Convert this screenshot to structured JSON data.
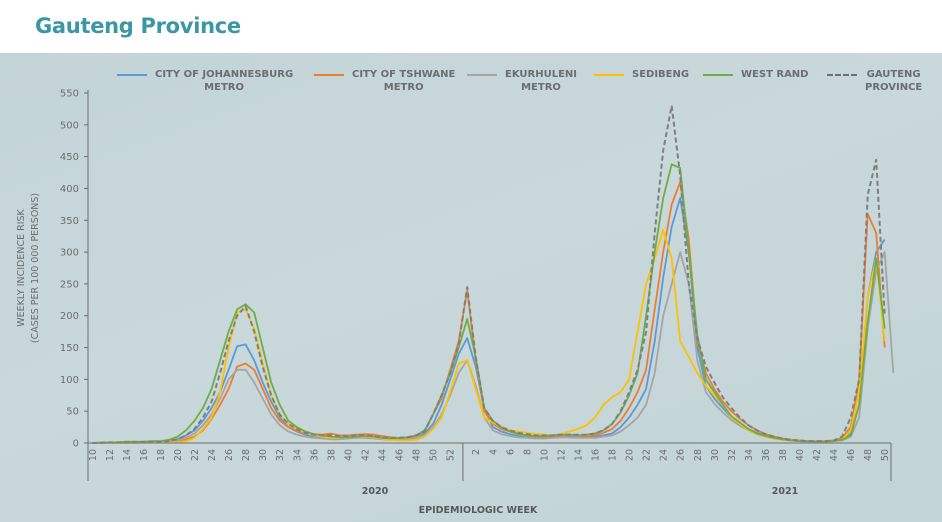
{
  "header": {
    "title": "Gauteng Province"
  },
  "chart_data": {
    "type": "line",
    "title": "Gauteng Province",
    "xlabel": "EPIDEMIOLOGIC WEEK",
    "ylabel_line1": "WEEKLY INCIDENCE RISK",
    "ylabel_line2": "(CASES PER 100 000 PERSONS)",
    "ylim": [
      0,
      550
    ],
    "yticks": [
      0,
      50,
      100,
      150,
      200,
      250,
      300,
      350,
      400,
      450,
      500,
      550
    ],
    "grid": false,
    "legend_position": "top",
    "year_groups": [
      {
        "label": "2020",
        "weeks": [
          10,
          11,
          12,
          13,
          14,
          15,
          16,
          17,
          18,
          19,
          20,
          21,
          22,
          23,
          24,
          25,
          26,
          27,
          28,
          29,
          30,
          31,
          32,
          33,
          34,
          35,
          36,
          37,
          38,
          39,
          40,
          41,
          42,
          43,
          44,
          45,
          46,
          47,
          48,
          49,
          50,
          51,
          52,
          53
        ]
      },
      {
        "label": "2021",
        "weeks": [
          1,
          2,
          3,
          4,
          5,
          6,
          7,
          8,
          9,
          10,
          11,
          12,
          13,
          14,
          15,
          16,
          17,
          18,
          19,
          20,
          21,
          22,
          23,
          24,
          25,
          26,
          27,
          28,
          29,
          30,
          31,
          32,
          33,
          34,
          35,
          36,
          37,
          38,
          39,
          40,
          41,
          42,
          43,
          44,
          45,
          46,
          47,
          48,
          49,
          50
        ]
      }
    ],
    "xtick_labels_2020": [
      "10",
      "12",
      "14",
      "16",
      "18",
      "20",
      "22",
      "24",
      "26",
      "28",
      "30",
      "32",
      "34",
      "36",
      "38",
      "40",
      "42",
      "44",
      "46",
      "48",
      "50",
      "52"
    ],
    "xtick_labels_2021": [
      "2",
      "4",
      "6",
      "8",
      "10",
      "12",
      "14",
      "16",
      "18",
      "20",
      "22",
      "24",
      "26",
      "28",
      "30",
      "32",
      "34",
      "36",
      "38",
      "40",
      "42",
      "44",
      "46",
      "48",
      "50"
    ],
    "series": [
      {
        "name": "CITY OF JOHANNESBURG METRO",
        "legend_line1": "CITY OF JOHANNESBURG",
        "legend_line2": "METRO",
        "color": "#5b9bd5",
        "dashed": false,
        "values": [
          0,
          0,
          1,
          1,
          1,
          1,
          1,
          2,
          2,
          3,
          6,
          12,
          20,
          35,
          55,
          80,
          115,
          152,
          155,
          130,
          95,
          65,
          40,
          25,
          18,
          13,
          10,
          9,
          8,
          8,
          9,
          10,
          10,
          9,
          8,
          7,
          7,
          8,
          10,
          15,
          30,
          60,
          100,
          140,
          165,
          120,
          55,
          25,
          18,
          14,
          11,
          9,
          8,
          8,
          9,
          10,
          10,
          9,
          9,
          10,
          12,
          15,
          25,
          40,
          60,
          85,
          160,
          260,
          340,
          385,
          300,
          150,
          90,
          70,
          55,
          40,
          30,
          22,
          16,
          12,
          8,
          6,
          4,
          3,
          2,
          2,
          2,
          3,
          5,
          15,
          60,
          230,
          300,
          320
        ]
      },
      {
        "name": "CITY OF TSHWANE METRO",
        "legend_line1": "CITY OF TSHWANE",
        "legend_line2": "METRO",
        "color": "#ed7d31",
        "dashed": false,
        "values": [
          0,
          0,
          1,
          1,
          1,
          1,
          1,
          1,
          2,
          2,
          3,
          5,
          10,
          20,
          38,
          60,
          85,
          120,
          125,
          115,
          85,
          55,
          35,
          25,
          20,
          15,
          14,
          13,
          15,
          12,
          12,
          13,
          14,
          13,
          11,
          9,
          8,
          9,
          11,
          18,
          45,
          70,
          115,
          160,
          240,
          130,
          50,
          30,
          22,
          18,
          15,
          12,
          10,
          10,
          10,
          10,
          9,
          9,
          10,
          12,
          16,
          22,
          35,
          55,
          80,
          115,
          210,
          300,
          375,
          410,
          320,
          160,
          110,
          85,
          65,
          50,
          38,
          28,
          20,
          14,
          10,
          7,
          5,
          4,
          3,
          3,
          3,
          4,
          8,
          25,
          100,
          360,
          330,
          150
        ]
      },
      {
        "name": "EKURHULENI METRO",
        "legend_line1": "EKURHULENI",
        "legend_line2": "METRO",
        "color": "#a5a5a5",
        "dashed": false,
        "values": [
          0,
          0,
          1,
          1,
          1,
          1,
          1,
          1,
          1,
          2,
          4,
          8,
          15,
          28,
          45,
          70,
          100,
          115,
          115,
          95,
          70,
          45,
          28,
          18,
          13,
          10,
          8,
          7,
          6,
          6,
          7,
          8,
          8,
          7,
          6,
          5,
          5,
          6,
          8,
          12,
          25,
          45,
          75,
          110,
          130,
          90,
          40,
          20,
          14,
          11,
          9,
          8,
          7,
          7,
          8,
          9,
          9,
          8,
          8,
          8,
          10,
          12,
          18,
          28,
          40,
          60,
          110,
          200,
          250,
          300,
          250,
          130,
          80,
          62,
          48,
          36,
          27,
          20,
          14,
          10,
          7,
          5,
          4,
          3,
          2,
          2,
          2,
          3,
          4,
          10,
          40,
          180,
          270,
          300,
          110
        ]
      },
      {
        "name": "SEDIBENG",
        "legend_line1": "SEDIBENG",
        "legend_line2": "",
        "color": "#ffc000",
        "dashed": false,
        "values": [
          0,
          0,
          0,
          0,
          0,
          0,
          1,
          1,
          1,
          1,
          1,
          3,
          8,
          22,
          40,
          80,
          150,
          205,
          210,
          180,
          125,
          75,
          45,
          30,
          22,
          16,
          12,
          10,
          8,
          8,
          9,
          10,
          10,
          9,
          7,
          5,
          4,
          4,
          5,
          10,
          22,
          40,
          80,
          125,
          130,
          85,
          40,
          32,
          25,
          20,
          18,
          16,
          14,
          13,
          12,
          14,
          18,
          22,
          28,
          40,
          60,
          72,
          80,
          100,
          175,
          250,
          290,
          335,
          290,
          160,
          135,
          110,
          90,
          75,
          60,
          40,
          30,
          20,
          14,
          10,
          7,
          5,
          4,
          3,
          3,
          2,
          2,
          3,
          5,
          20,
          80,
          230,
          290,
          160
        ]
      },
      {
        "name": "WEST RAND",
        "legend_line1": "WEST RAND",
        "legend_line2": "",
        "color": "#70ad47",
        "dashed": false,
        "values": [
          0,
          1,
          1,
          1,
          2,
          2,
          2,
          3,
          3,
          5,
          10,
          20,
          35,
          55,
          85,
          130,
          175,
          210,
          218,
          205,
          150,
          95,
          60,
          35,
          25,
          18,
          14,
          12,
          10,
          9,
          9,
          10,
          11,
          10,
          8,
          7,
          8,
          9,
          12,
          20,
          45,
          75,
          110,
          150,
          195,
          135,
          55,
          35,
          25,
          18,
          14,
          12,
          11,
          11,
          12,
          13,
          13,
          12,
          13,
          15,
          20,
          30,
          48,
          75,
          110,
          200,
          300,
          385,
          438,
          432,
          300,
          170,
          100,
          80,
          60,
          42,
          32,
          22,
          15,
          11,
          8,
          6,
          4,
          3,
          3,
          2,
          2,
          3,
          5,
          12,
          60,
          190,
          290,
          180
        ]
      },
      {
        "name": "GAUTENG PROVINCE",
        "legend_line1": "GAUTENG",
        "legend_line2": "PROVINCE",
        "color": "#7f7f7f",
        "dashed": true,
        "values": [
          0,
          0,
          1,
          1,
          1,
          1,
          1,
          2,
          2,
          3,
          6,
          12,
          22,
          40,
          65,
          110,
          160,
          200,
          215,
          175,
          120,
          75,
          45,
          30,
          22,
          16,
          13,
          12,
          12,
          11,
          11,
          12,
          12,
          11,
          9,
          8,
          8,
          9,
          12,
          18,
          45,
          75,
          110,
          155,
          245,
          135,
          55,
          35,
          25,
          20,
          16,
          14,
          12,
          12,
          12,
          13,
          13,
          13,
          13,
          15,
          20,
          30,
          50,
          80,
          115,
          175,
          330,
          460,
          530,
          420,
          250,
          165,
          120,
          95,
          72,
          55,
          40,
          28,
          20,
          14,
          10,
          7,
          5,
          4,
          3,
          3,
          3,
          4,
          10,
          40,
          100,
          390,
          445,
          200
        ]
      }
    ]
  }
}
